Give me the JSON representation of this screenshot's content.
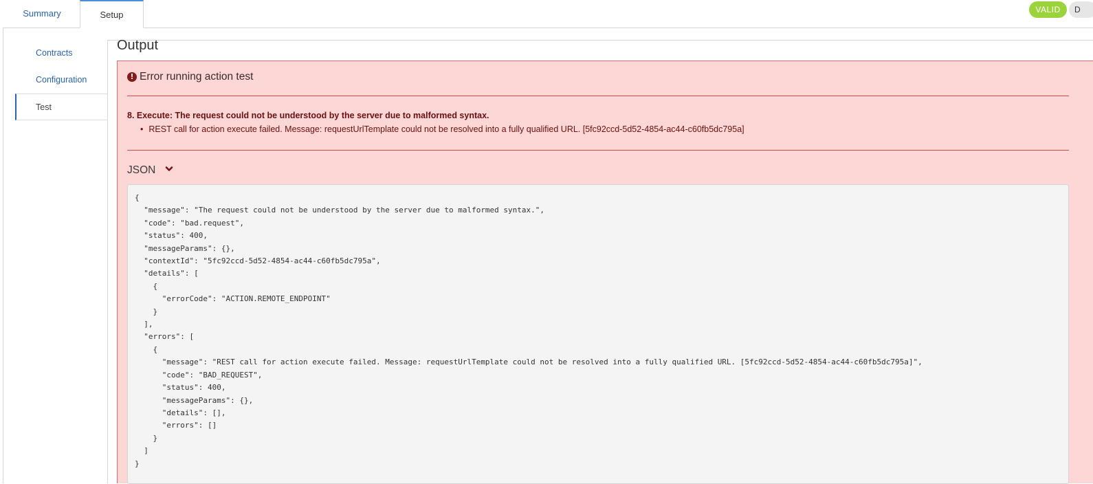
{
  "tabs": [
    {
      "label": "Summary",
      "active": false
    },
    {
      "label": "Setup",
      "active": true
    }
  ],
  "status_badge": {
    "label": "VALID",
    "color": "#9bd33b"
  },
  "status_badge_cut": {
    "label": "D"
  },
  "sidebar": {
    "items": [
      {
        "label": "Contracts",
        "active": false
      },
      {
        "label": "Configuration",
        "active": false
      },
      {
        "label": "Test",
        "active": true
      }
    ]
  },
  "output": {
    "title": "Output",
    "error": {
      "title": "Error running action test",
      "icon": "exclamation-circle-icon",
      "summary": "8. Execute: The request could not be understood by the server due to malformed syntax.",
      "details": [
        "REST call for action execute failed. Message: requestUrlTemplate could not be resolved into a fully qualified URL. [5fc92ccd-5d52-4854-ac44-c60fb5dc795a]"
      ]
    },
    "json_toggle": {
      "label": "JSON",
      "icon": "chevron-down-icon"
    },
    "json_text": "{\n  \"message\": \"The request could not be understood by the server due to malformed syntax.\",\n  \"code\": \"bad.request\",\n  \"status\": 400,\n  \"messageParams\": {},\n  \"contextId\": \"5fc92ccd-5d52-4854-ac44-c60fb5dc795a\",\n  \"details\": [\n    {\n      \"errorCode\": \"ACTION.REMOTE_ENDPOINT\"\n    }\n  ],\n  \"errors\": [\n    {\n      \"message\": \"REST call for action execute failed. Message: requestUrlTemplate could not be resolved into a fully qualified URL. [5fc92ccd-5d52-4854-ac44-c60fb5dc795a]\",\n      \"code\": \"BAD_REQUEST\",\n      \"status\": 400,\n      \"messageParams\": {},\n      \"details\": [],\n      \"errors\": []\n    }\n  ]\n}"
  },
  "colors": {
    "link": "#2a63b5",
    "error_bg": "#fdd6d6",
    "error_border": "#e06c6c",
    "error_text": "#6b1010"
  }
}
